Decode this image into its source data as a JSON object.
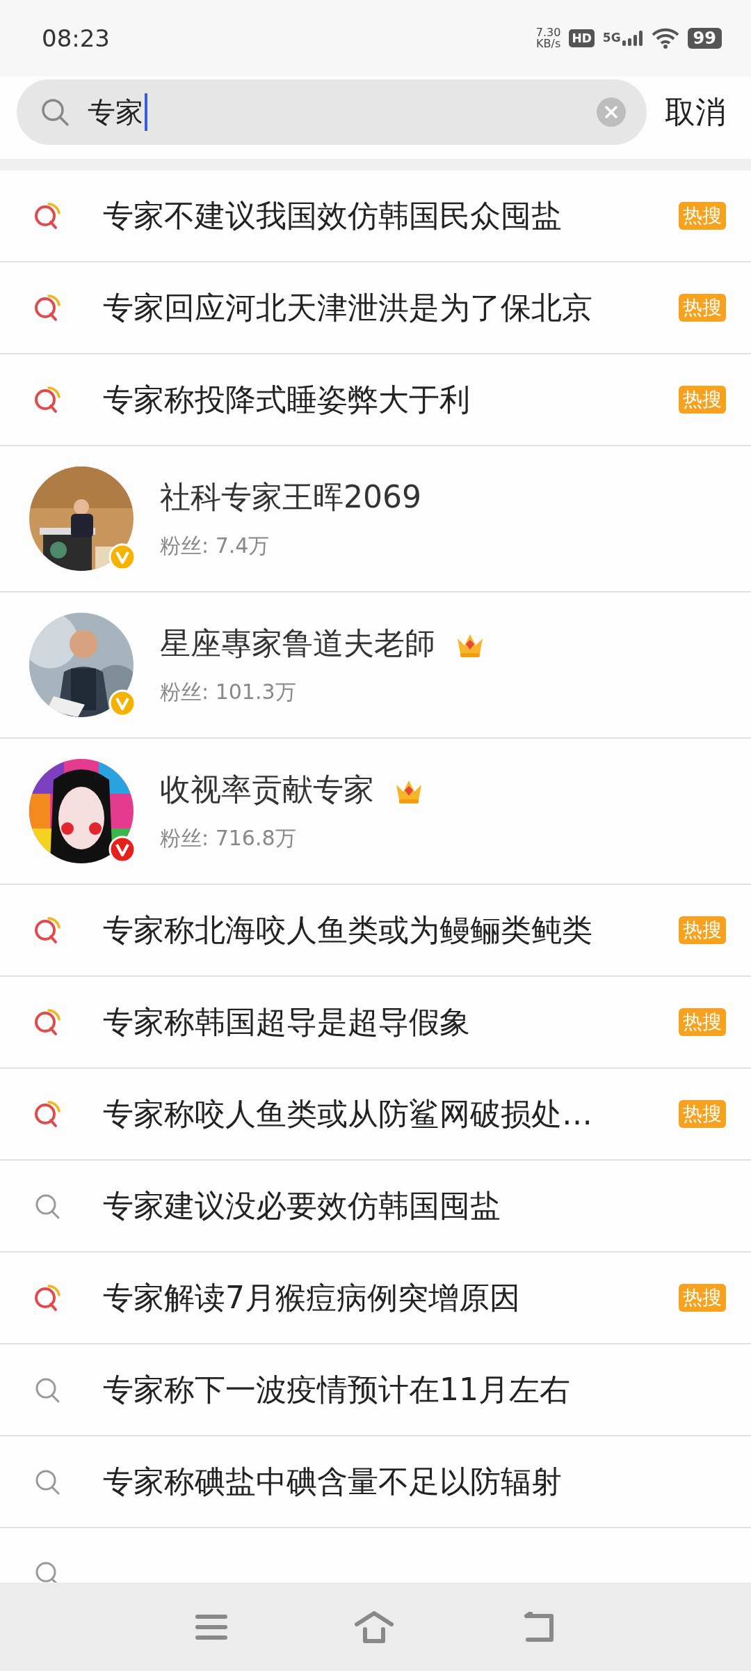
{
  "status_bar": {
    "time": "08:23",
    "speed": "7.30",
    "speed_unit": "KB/s",
    "hd": "HD",
    "network": "5G",
    "battery": "99"
  },
  "search": {
    "value": "专家",
    "cancel": "取消"
  },
  "results": [
    {
      "kind": "query",
      "text": "专家不建议我国效仿韩国民众囤盐",
      "hot": true,
      "badge": "热搜"
    },
    {
      "kind": "query",
      "text": "专家回应河北天津泄洪是为了保北京",
      "hot": true,
      "badge": "热搜"
    },
    {
      "kind": "query",
      "text": "专家称投降式睡姿弊大于利",
      "hot": true,
      "badge": "热搜"
    },
    {
      "kind": "user",
      "name": "社科专家王晖2069",
      "fans": "粉丝: 7.4万",
      "crown": false,
      "color": "#f5b300"
    },
    {
      "kind": "user",
      "name": "星座專家鲁道夫老師",
      "fans": "粉丝: 101.3万",
      "crown": true,
      "color": "#f5b300"
    },
    {
      "kind": "user",
      "name": "收视率贡献专家",
      "fans": "粉丝: 716.8万",
      "crown": true,
      "color": "#e8201c"
    },
    {
      "kind": "query",
      "text": "专家称北海咬人鱼类或为鳗鲡类鲀类",
      "hot": true,
      "badge": "热搜"
    },
    {
      "kind": "query",
      "text": "专家称韩国超导是超导假象",
      "hot": true,
      "badge": "热搜"
    },
    {
      "kind": "query",
      "text": "专家称咬人鱼类或从防鲨网破损处…",
      "hot": true,
      "badge": "热搜"
    },
    {
      "kind": "query",
      "text": "专家建议没必要效仿韩国囤盐",
      "hot": false
    },
    {
      "kind": "query",
      "text": "专家解读7月猴痘病例突增原因",
      "hot": true,
      "badge": "热搜"
    },
    {
      "kind": "query",
      "text": "专家称下一波疫情预计在11月左右",
      "hot": false
    },
    {
      "kind": "query",
      "text": "专家称碘盐中碘含量不足以防辐射",
      "hot": false
    },
    {
      "kind": "query",
      "hot": false
    }
  ]
}
